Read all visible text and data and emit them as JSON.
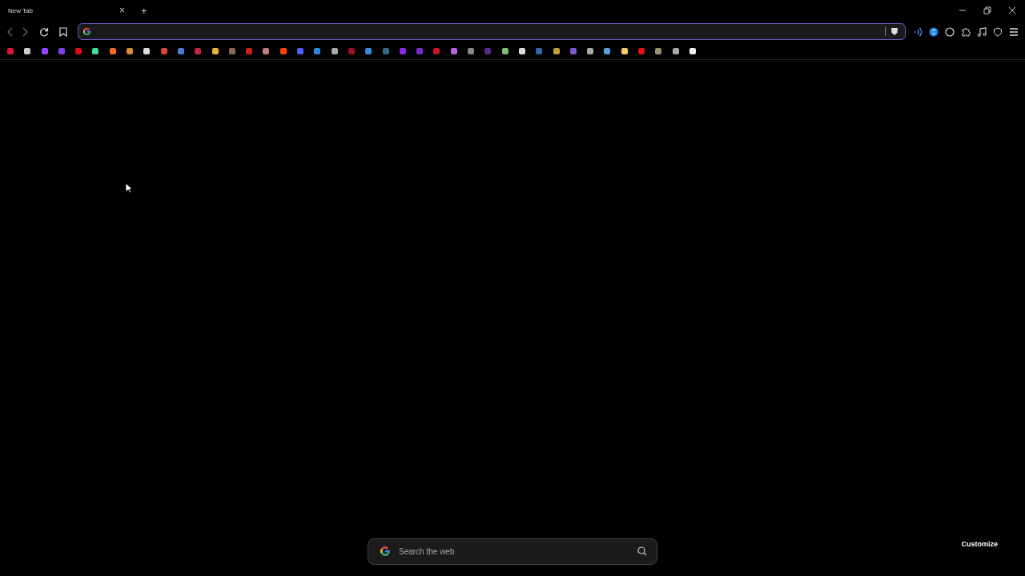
{
  "tab": {
    "title": "New Tab",
    "close": "×",
    "new_tab": "+"
  },
  "bookmarks": [
    {
      "color": "#e0123a"
    },
    {
      "color": "#cccccc"
    },
    {
      "color": "#9146ff"
    },
    {
      "color": "#7b3ff2"
    },
    {
      "color": "#e50914"
    },
    {
      "color": "#3ddc97"
    },
    {
      "color": "#f26b1d"
    },
    {
      "color": "#d98a3a"
    },
    {
      "color": "#dddddd"
    },
    {
      "color": "#d44638"
    },
    {
      "color": "#4a7bd6"
    },
    {
      "color": "#c0273a"
    },
    {
      "color": "#e8b040"
    },
    {
      "color": "#8a6a50"
    },
    {
      "color": "#d0201a"
    },
    {
      "color": "#c08080"
    },
    {
      "color": "#ff4500"
    },
    {
      "color": "#4a5ff0"
    },
    {
      "color": "#2a8ae0"
    },
    {
      "color": "#aaaaaa"
    },
    {
      "color": "#a01020"
    },
    {
      "color": "#2f8ee0"
    },
    {
      "color": "#2a6e8a"
    },
    {
      "color": "#8a2be2"
    },
    {
      "color": "#7a2ed0"
    },
    {
      "color": "#d0102a"
    },
    {
      "color": "#c060e0"
    },
    {
      "color": "#888888"
    },
    {
      "color": "#5a2a8a"
    },
    {
      "color": "#7ac070"
    },
    {
      "color": "#dddddd"
    },
    {
      "color": "#2a6ab0"
    },
    {
      "color": "#c0a030"
    },
    {
      "color": "#7a5ad0"
    },
    {
      "color": "#aaaaaa"
    },
    {
      "color": "#5aa0e0"
    },
    {
      "color": "#f0d060"
    },
    {
      "color": "#e01010"
    },
    {
      "color": "#a09070"
    },
    {
      "color": "#aaaaaa"
    },
    {
      "color": "#eeeeee"
    }
  ],
  "search": {
    "placeholder": "Search the web"
  },
  "customize": "Customize"
}
